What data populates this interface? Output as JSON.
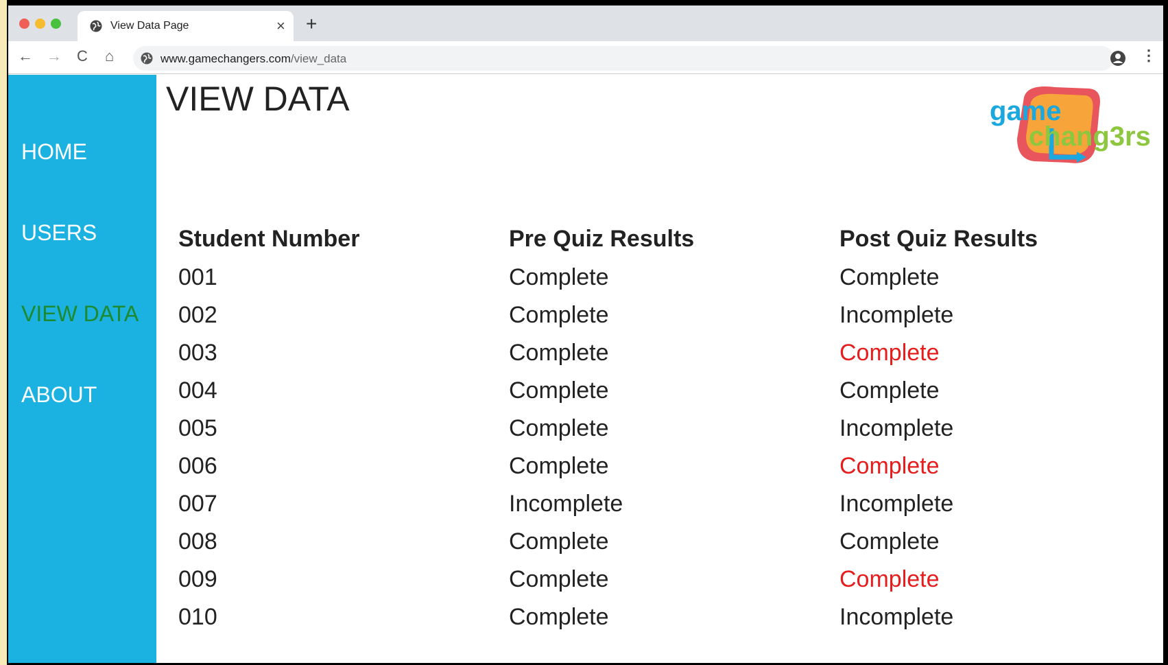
{
  "browser": {
    "tab_title": "View Data Page",
    "tab_close": "×",
    "new_tab": "+",
    "url_host": "www.gamechangers.com",
    "url_path": "/view_data",
    "back": "←",
    "forward": "→",
    "reload": "C",
    "home": "⌂",
    "menu": "⋮"
  },
  "sidebar": {
    "items": [
      {
        "label": "HOME"
      },
      {
        "label": "USERS"
      },
      {
        "label": "VIEW DATA"
      },
      {
        "label": "ABOUT"
      }
    ],
    "active": "VIEW DATA",
    "active_color": "#1c8a2e",
    "background": "#1bb2e1"
  },
  "main": {
    "title": "VIEW DATA",
    "logo": {
      "line1": "game",
      "line2": "chang3rs"
    }
  },
  "table": {
    "headers": [
      "Student Number",
      "Pre Quiz Results",
      "Post Quiz Results"
    ],
    "rows": [
      {
        "student": "001",
        "pre": "Complete",
        "post": "Complete",
        "post_highlight": false
      },
      {
        "student": "002",
        "pre": "Complete",
        "post": "Incomplete",
        "post_highlight": false
      },
      {
        "student": "003",
        "pre": "Complete",
        "post": "Complete",
        "post_highlight": true
      },
      {
        "student": "004",
        "pre": "Complete",
        "post": "Complete",
        "post_highlight": false
      },
      {
        "student": "005",
        "pre": "Complete",
        "post": "Incomplete",
        "post_highlight": false
      },
      {
        "student": "006",
        "pre": "Complete",
        "post": "Complete",
        "post_highlight": true
      },
      {
        "student": "007",
        "pre": "Incomplete",
        "post": "Incomplete",
        "post_highlight": false
      },
      {
        "student": "008",
        "pre": "Complete",
        "post": "Complete",
        "post_highlight": false
      },
      {
        "student": "009",
        "pre": "Complete",
        "post": "Complete",
        "post_highlight": true
      },
      {
        "student": "010",
        "pre": "Complete",
        "post": "Incomplete",
        "post_highlight": false
      }
    ],
    "highlight_color": "#e51d1d"
  }
}
